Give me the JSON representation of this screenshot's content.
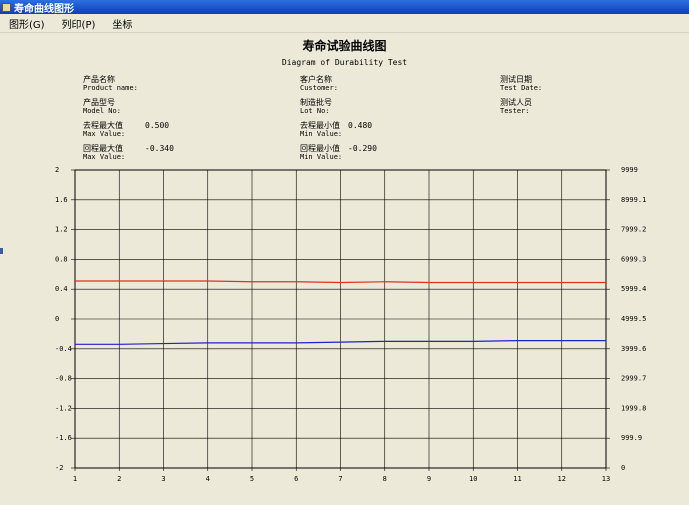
{
  "window": {
    "title": "寿命曲线图形"
  },
  "menu": {
    "items": [
      {
        "label": "图形(G)"
      },
      {
        "label": "列印(P)"
      },
      {
        "label": "坐标"
      }
    ]
  },
  "report": {
    "title": "寿命试验曲线图",
    "subtitle": "Diagram of Durability Test"
  },
  "info": {
    "product_name": {
      "cn": "产品名称",
      "en": "Product name:",
      "value": ""
    },
    "customer": {
      "cn": "客户名称",
      "en": "Customer:",
      "value": ""
    },
    "test_date": {
      "cn": "测试日期",
      "en": "Test Date:",
      "value": ""
    },
    "model_no": {
      "cn": "产品型号",
      "en": "Model No:",
      "value": ""
    },
    "lot_no": {
      "cn": "制造批号",
      "en": "Lot No:",
      "value": ""
    },
    "tester": {
      "cn": "测试人员",
      "en": "Tester:",
      "value": ""
    },
    "forward_max": {
      "cn": "去程最大值",
      "en": "Max Value:",
      "value": "0.500"
    },
    "forward_min": {
      "cn": "去程最小值",
      "en": "Min Value:",
      "value": "0.480"
    },
    "return_max": {
      "cn": "回程最大值",
      "en": "Max Value:",
      "value": "-0.340"
    },
    "return_min": {
      "cn": "回程最小值",
      "en": "Min Value:",
      "value": "-0.290"
    }
  },
  "chart_data": {
    "type": "line",
    "x_ticks": [
      "1",
      "2",
      "3",
      "4",
      "5",
      "6",
      "7",
      "8",
      "9",
      "10",
      "11",
      "12",
      "13"
    ],
    "y_left_ticks": [
      "2",
      "1.6",
      "1.2",
      "0.8",
      "0.4",
      "0",
      "-0.4",
      "-0.8",
      "-1.2",
      "-1.6",
      "-2"
    ],
    "y_right_ticks": [
      "9999",
      "8999.1",
      "7999.2",
      "6999.3",
      "5999.4",
      "4999.5",
      "3999.6",
      "2999.7",
      "1999.8",
      "999.9",
      "0"
    ],
    "xlim": [
      1,
      13
    ],
    "ylim": [
      -2,
      2
    ],
    "y2lim": [
      0,
      9999
    ],
    "grid": true,
    "series": [
      {
        "color": "#e03020",
        "x": [
          1,
          2,
          3,
          4,
          5,
          6,
          7,
          8,
          9,
          10,
          11,
          12,
          13
        ],
        "values": [
          0.51,
          0.51,
          0.51,
          0.51,
          0.5,
          0.5,
          0.49,
          0.5,
          0.49,
          0.49,
          0.49,
          0.49,
          0.49
        ]
      },
      {
        "color": "#2020d0",
        "x": [
          1,
          2,
          3,
          4,
          5,
          6,
          7,
          8,
          9,
          10,
          11,
          12,
          13
        ],
        "values": [
          -0.34,
          -0.34,
          -0.33,
          -0.32,
          -0.32,
          -0.32,
          -0.31,
          -0.3,
          -0.3,
          -0.3,
          -0.29,
          -0.29,
          -0.29
        ]
      }
    ]
  }
}
